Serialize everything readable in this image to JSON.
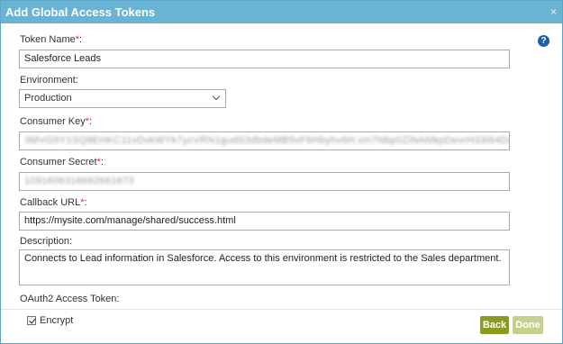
{
  "dialog": {
    "title": "Add Global Access Tokens",
    "close_symbol": "×"
  },
  "help": {
    "symbol": "?"
  },
  "fields": {
    "token_name": {
      "label": "Token Name",
      "required": "*",
      "suffix": ":",
      "value": "Salesforce Leads"
    },
    "environment": {
      "label": "Environment:",
      "value": "Production"
    },
    "consumer_key": {
      "label": "Consumer Key",
      "required": "*",
      "suffix": ":",
      "value": "3MVG9Y1SQ8EHKC11vDvkWYk7ycVRN1gudS3dbdeMB5vF6Hbyhv6H.vm7Nbp0ZiNAMkpDevrH33I64DzfgM"
    },
    "consumer_secret": {
      "label": "Consumer Secret",
      "required": "*",
      "suffix": ":",
      "value": "1091606316662661673"
    },
    "callback_url": {
      "label": "Callback URL",
      "required": "*",
      "suffix": ":",
      "value": "https://mysite.com/manage/shared/success.html"
    },
    "description": {
      "label": "Description:",
      "value": "Connects to Lead information in Salesforce. Access to this environment is restricted to the Sales department."
    },
    "oauth2": {
      "label": "OAuth2 Access Token:"
    }
  },
  "footer": {
    "encrypt_label": "Encrypt",
    "back_label": "Back",
    "done_label": "Done"
  },
  "colors": {
    "titlebar": "#6bb3d3",
    "back_button": "#8b9a20",
    "done_button": "#c6cf8e",
    "required": "#d32f2f",
    "help": "#1f5ea8"
  }
}
